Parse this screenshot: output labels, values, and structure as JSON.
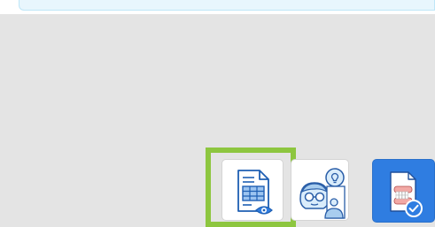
{
  "app_header": {
    "banner": ""
  },
  "dock": {
    "items": [
      {
        "icon": "document-table-preview-icon",
        "selected": true
      },
      {
        "icon": "person-idea-reading-icon",
        "selected": false
      },
      {
        "icon": "dental-document-check-icon",
        "selected": false
      }
    ]
  },
  "colors": {
    "selection": "#8dc63f",
    "accent_blue": "#2f7de1",
    "background": "#e4e4e4"
  }
}
